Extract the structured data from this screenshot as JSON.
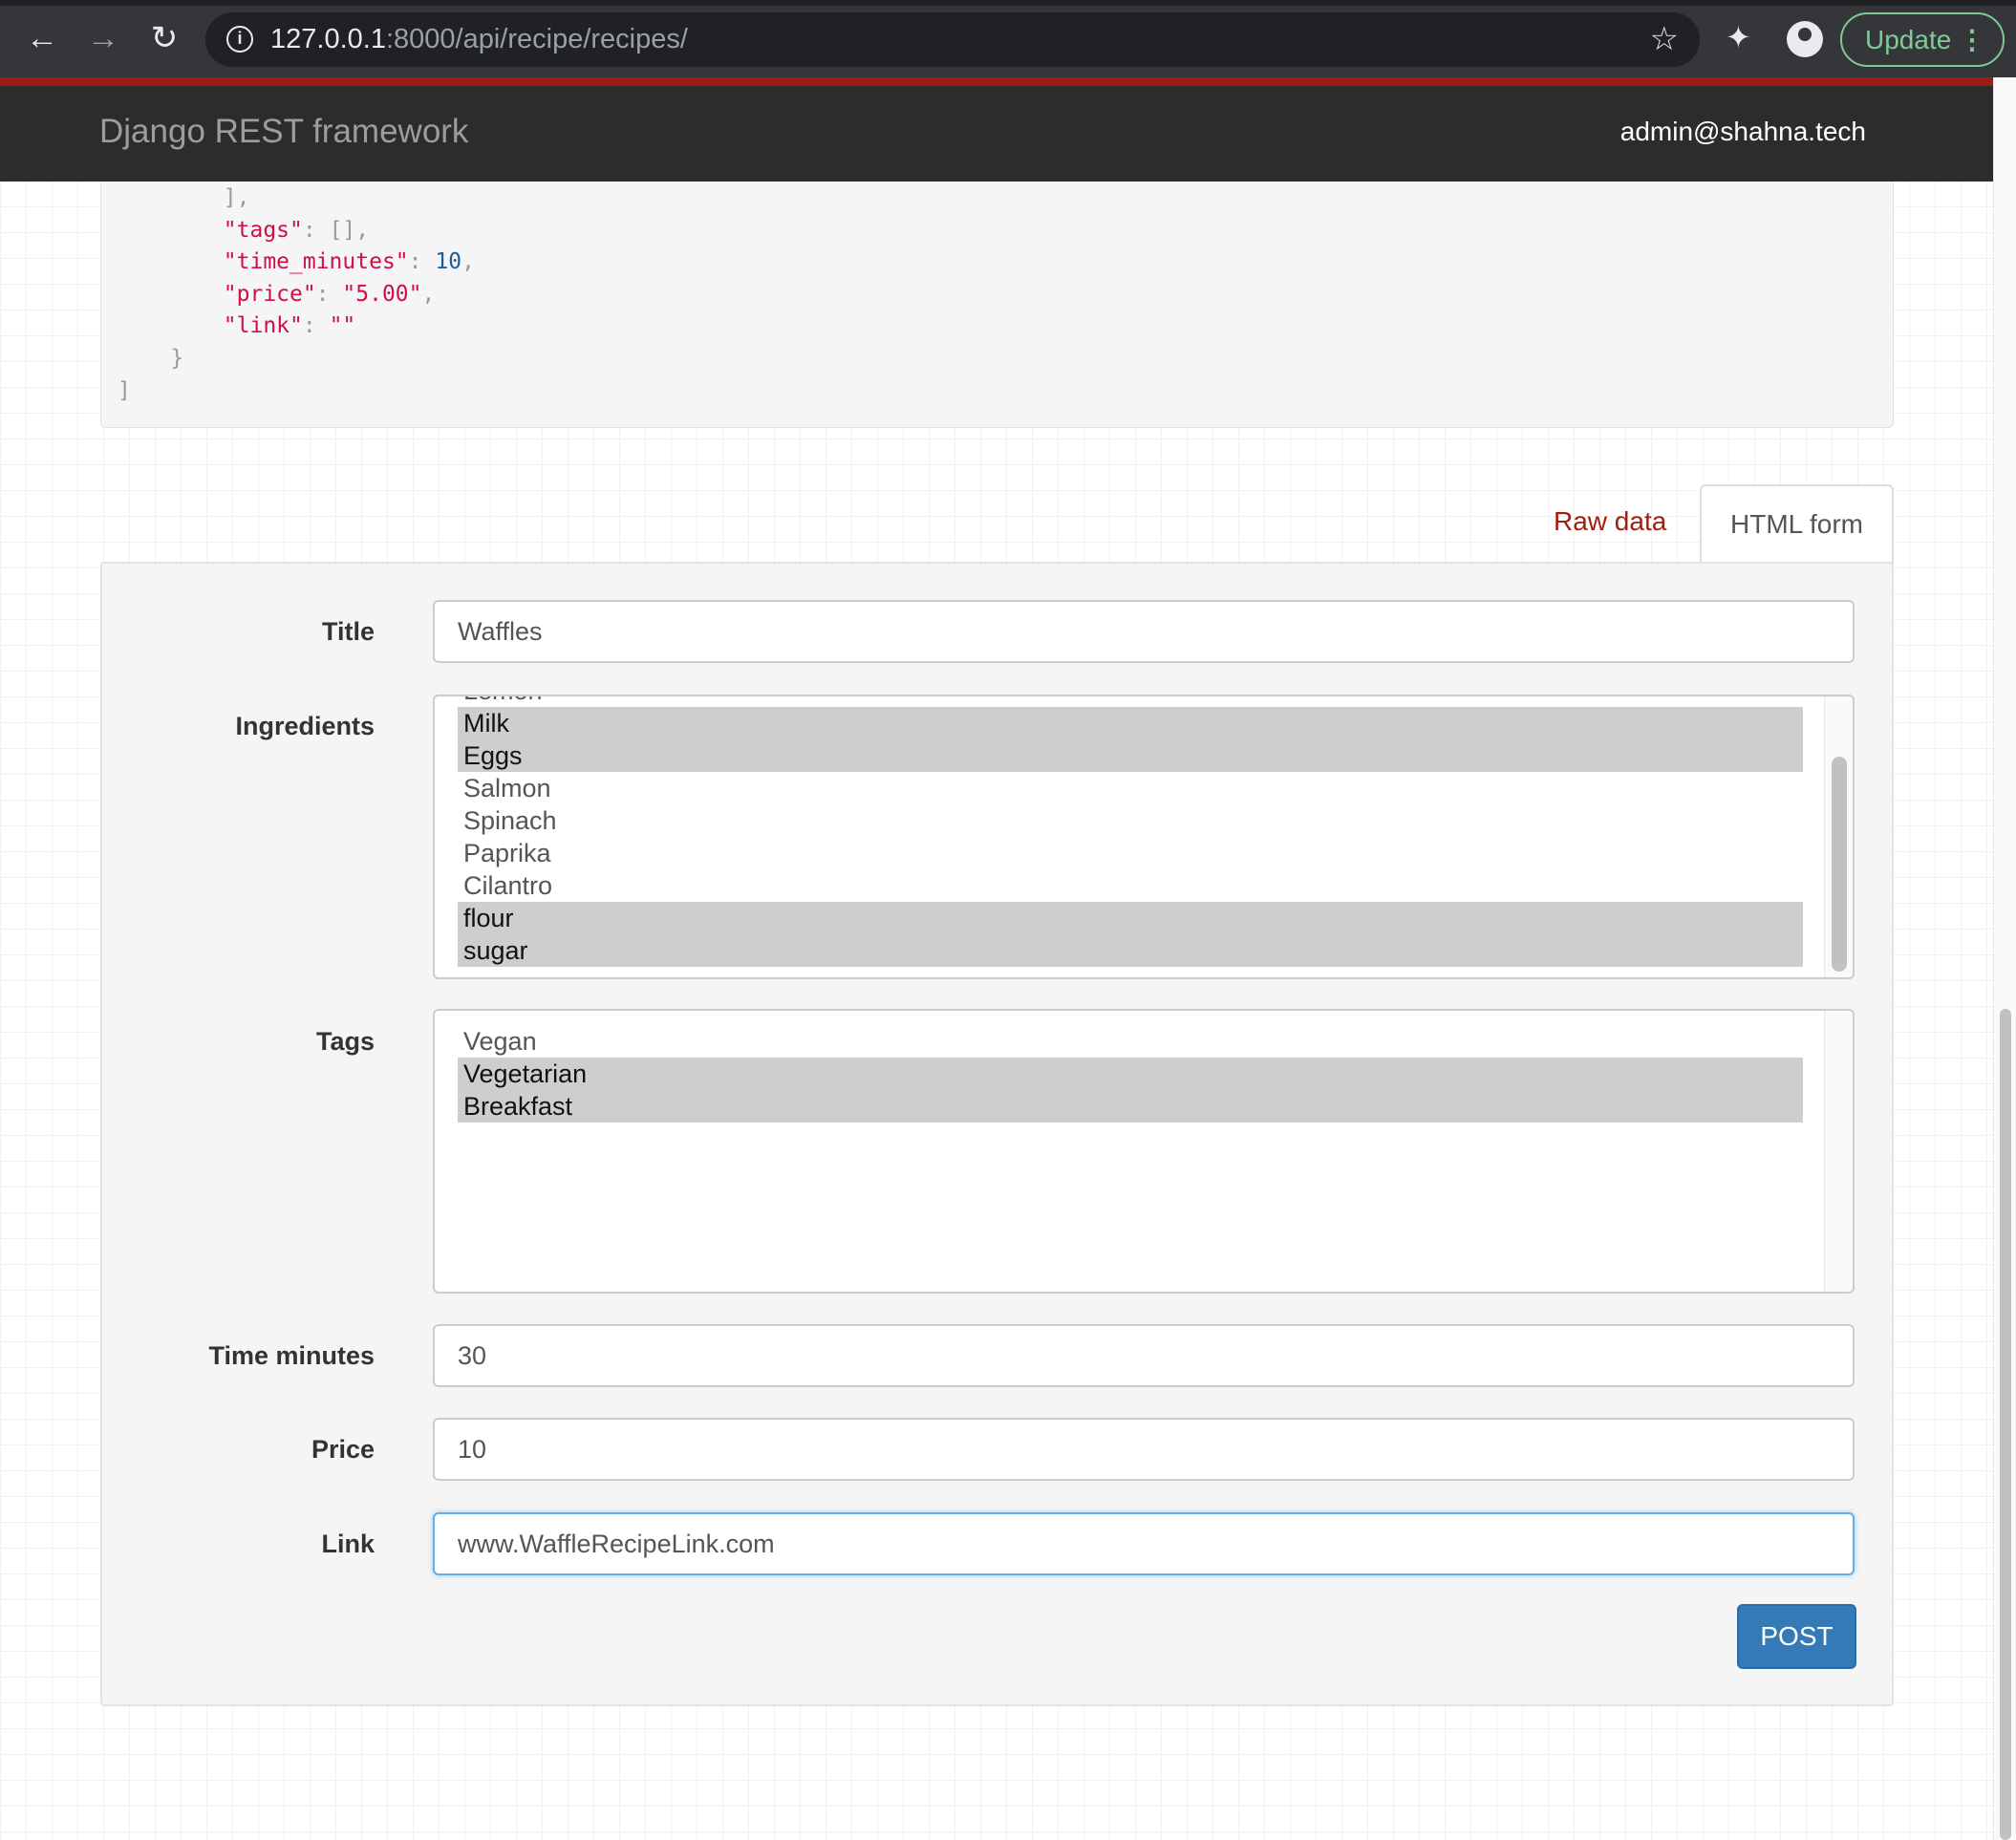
{
  "browser": {
    "url_host": "127.0.0.1",
    "url_path": ":8000/api/recipe/recipes/",
    "update_label": "Update",
    "icons": [
      "back-icon",
      "forward-icon",
      "reload-icon",
      "info-icon",
      "star-icon",
      "extensions-icon",
      "profile-icon",
      "menu-icon"
    ]
  },
  "navbar": {
    "brand": "Django REST framework",
    "user": "admin@shahna.tech"
  },
  "json_response": {
    "lines": [
      {
        "indent": "        ",
        "text": "],"
      },
      {
        "indent": "        ",
        "key": "\"tags\"",
        "sep": ": ",
        "val": "[],",
        "valtype": "punct"
      },
      {
        "indent": "        ",
        "key": "\"time_minutes\"",
        "sep": ": ",
        "val": "10",
        "valtype": "num",
        "tail": ","
      },
      {
        "indent": "        ",
        "key": "\"price\"",
        "sep": ": ",
        "val": "\"5.00\"",
        "valtype": "str",
        "tail": ","
      },
      {
        "indent": "        ",
        "key": "\"link\"",
        "sep": ": ",
        "val": "\"\"",
        "valtype": "str"
      },
      {
        "indent": "    ",
        "text": "}"
      },
      {
        "indent": "",
        "text": "]"
      }
    ]
  },
  "tabs": {
    "raw": "Raw data",
    "html": "HTML form",
    "active": "HTML form"
  },
  "form": {
    "title": {
      "label": "Title",
      "value": "Waffles"
    },
    "ingredients": {
      "label": "Ingredients",
      "options": [
        {
          "text": "Lemon",
          "selected": false
        },
        {
          "text": "Milk",
          "selected": true
        },
        {
          "text": "Eggs",
          "selected": true
        },
        {
          "text": "Salmon",
          "selected": false
        },
        {
          "text": "Spinach",
          "selected": false
        },
        {
          "text": "Paprika",
          "selected": false
        },
        {
          "text": "Cilantro",
          "selected": false
        },
        {
          "text": "flour",
          "selected": true
        },
        {
          "text": "sugar",
          "selected": true
        }
      ]
    },
    "tags": {
      "label": "Tags",
      "options": [
        {
          "text": "Vegan",
          "selected": false
        },
        {
          "text": "Vegetarian",
          "selected": true
        },
        {
          "text": "Breakfast",
          "selected": true
        }
      ]
    },
    "time_minutes": {
      "label": "Time minutes",
      "value": "30"
    },
    "price": {
      "label": "Price",
      "value": "10"
    },
    "link": {
      "label": "Link",
      "value": "www.WaffleRecipeLink.com"
    },
    "submit": "POST"
  },
  "colors": {
    "accent_red": "#a51d0f",
    "navbar": "#2c2c2c",
    "button": "#337ab7",
    "selected_option": "#cecece"
  }
}
